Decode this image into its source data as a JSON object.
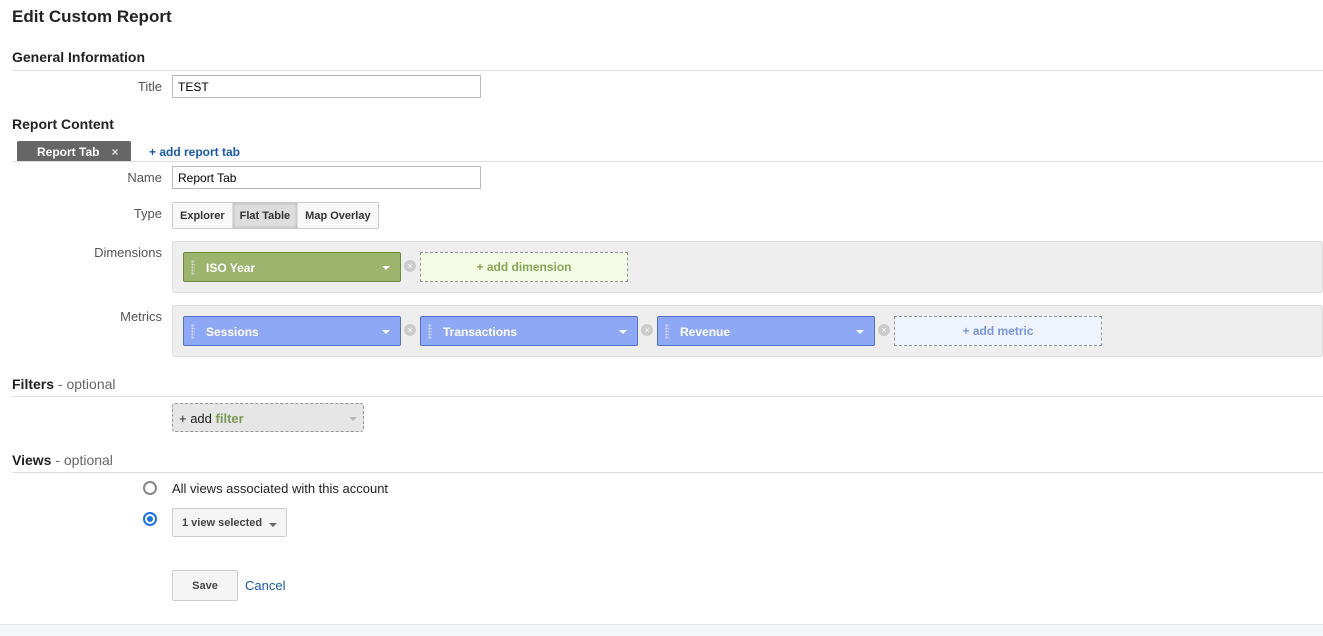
{
  "page_title": "Edit Custom Report",
  "general": {
    "heading": "General Information",
    "title_label": "Title",
    "title_value": "TEST"
  },
  "content": {
    "heading": "Report Content",
    "tab_label": "Report Tab",
    "tab_close": "×",
    "add_tab": "+ add report tab",
    "name_label": "Name",
    "name_value": "Report Tab",
    "type_label": "Type",
    "types": [
      "Explorer",
      "Flat Table",
      "Map Overlay"
    ],
    "selected_type": "Flat Table",
    "dimensions_label": "Dimensions",
    "dimensions": [
      "ISO Year"
    ],
    "add_dimension": "+ add dimension",
    "metrics_label": "Metrics",
    "metrics": [
      "Sessions",
      "Transactions",
      "Revenue"
    ],
    "add_metric": "+ add metric",
    "remove_glyph": "×"
  },
  "filters": {
    "heading": "Filters",
    "optional": " - optional",
    "add_prefix": "+ add ",
    "add_word": "filter"
  },
  "views": {
    "heading": "Views",
    "optional": " - optional",
    "option_all": "All views associated with this account",
    "selected": "1 view selected",
    "selected_option": 2
  },
  "actions": {
    "save": "Save",
    "cancel": "Cancel"
  },
  "colors": {
    "dimension": "#9db46e",
    "metric": "#8fa8f5",
    "link": "#1a5aa6",
    "tab": "#666666"
  }
}
